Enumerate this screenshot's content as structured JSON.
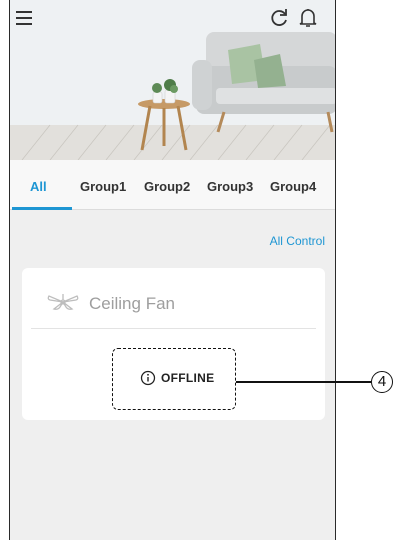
{
  "header": {
    "icons": [
      "menu-icon",
      "refresh-icon",
      "bell-icon"
    ]
  },
  "tabs": [
    {
      "label": "All",
      "active": true
    },
    {
      "label": "Group1",
      "active": false
    },
    {
      "label": "Group2",
      "active": false
    },
    {
      "label": "Group3",
      "active": false
    },
    {
      "label": "Group4",
      "active": false
    }
  ],
  "main": {
    "all_control_label": "All Control",
    "device": {
      "name": "Ceiling Fan",
      "icon": "ceiling-fan-icon",
      "status": "OFFLINE",
      "status_icon": "info-icon"
    }
  },
  "callout": {
    "label": "4"
  },
  "colors": {
    "accent": "#1e96d3",
    "sofa": "#d5d7d8",
    "cushion": "#a9c3a3"
  }
}
